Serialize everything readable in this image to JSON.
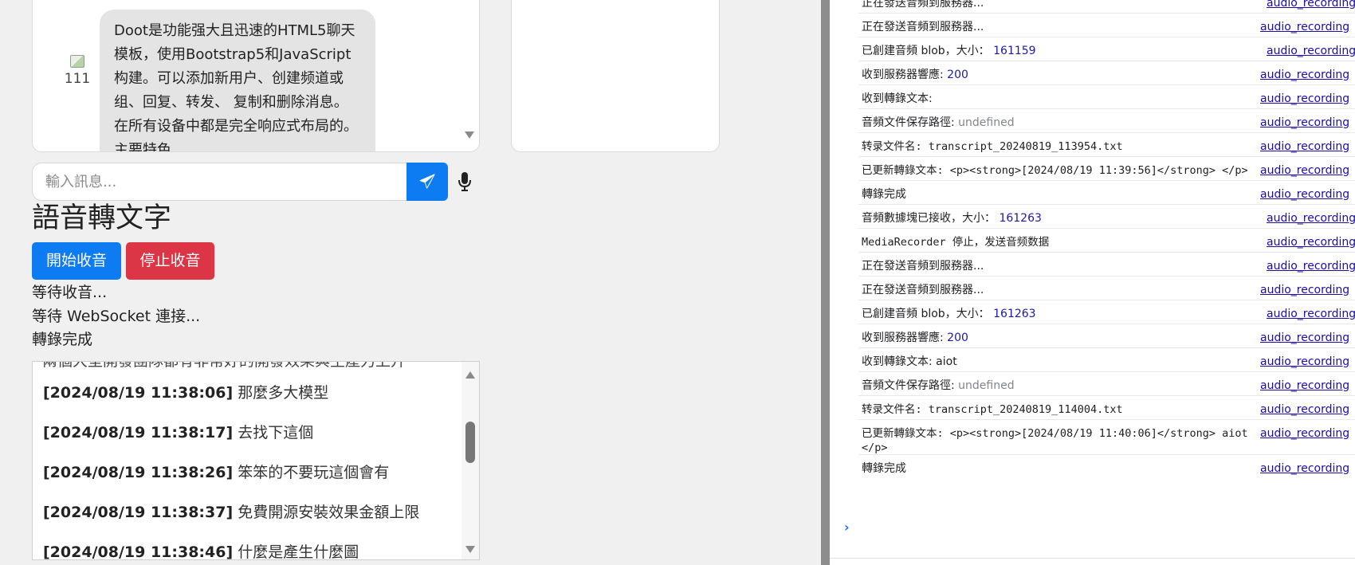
{
  "chat": {
    "avatar_alt": "111",
    "bubble_text": "Doot是功能强大且迅速的HTML5聊天模板，使用Bootstrap5和JavaScript构建。可以添加新用户、创建频道或组、回复、转发、 复制和删除消息。在所有设备中都是完全响应式布局的。主要特色"
  },
  "composer": {
    "placeholder": "輸入訊息..."
  },
  "stt": {
    "title": "語音轉文字",
    "start_label": "開始收音",
    "stop_label": "停止收音",
    "status_recording": "等待收音...",
    "status_ws": "等待 WebSocket 連接...",
    "status_done": "轉錄完成"
  },
  "transcript": {
    "partial_top": "兩個大型開發團隊都有非常好的開發效果與生產力上升",
    "entries": [
      {
        "time": "[2024/08/19 11:38:06]",
        "text": "那麼多大模型"
      },
      {
        "time": "[2024/08/19 11:38:17]",
        "text": "去找下這個"
      },
      {
        "time": "[2024/08/19 11:38:26]",
        "text": "笨笨的不要玩這個會有"
      },
      {
        "time": "[2024/08/19 11:38:37]",
        "text": "免費開源安裝效果金額上限"
      },
      {
        "time": "[2024/08/19 11:38:46]",
        "text": "什麼是產生什麼圖"
      }
    ]
  },
  "console": {
    "source_label": "audio_recording",
    "rows": [
      {
        "text": "正在發送音頻到服務器...",
        "num": "",
        "undef": "",
        "mono": false
      },
      {
        "text": "正在發送音頻到服務器...",
        "num": "",
        "undef": "",
        "mono": false
      },
      {
        "text": "已創建音頻 blob，大小： ",
        "num": "161159",
        "undef": "",
        "mono": false
      },
      {
        "text": "收到服務器響應: ",
        "num": "200",
        "undef": "",
        "mono": false
      },
      {
        "text": "收到轉錄文本: ",
        "num": "",
        "undef": "",
        "mono": false
      },
      {
        "text": "音頻文件保存路徑: ",
        "num": "",
        "undef": "undefined",
        "mono": false
      },
      {
        "text": "转录文件名: transcript_20240819_113954.txt",
        "num": "",
        "undef": "",
        "mono": false
      },
      {
        "text": "已更新轉錄文本: <p><strong>[2024/08/19 11:39:56]</strong> </p>",
        "num": "",
        "undef": "",
        "mono": false
      },
      {
        "text": "轉錄完成",
        "num": "",
        "undef": "",
        "mono": false
      },
      {
        "text": "音頻數據塊已接收，大小： ",
        "num": "161263",
        "undef": "",
        "mono": false
      },
      {
        "text": "MediaRecorder 停止，发送音频数据",
        "num": "",
        "undef": "",
        "mono": false
      },
      {
        "text": "正在發送音頻到服務器...",
        "num": "",
        "undef": "",
        "mono": false
      },
      {
        "text": "正在發送音頻到服務器...",
        "num": "",
        "undef": "",
        "mono": false
      },
      {
        "text": "已創建音頻 blob，大小： ",
        "num": "161263",
        "undef": "",
        "mono": false
      },
      {
        "text": "收到服務器響應: ",
        "num": "200",
        "undef": "",
        "mono": false
      },
      {
        "text": "收到轉錄文本: aiot",
        "num": "",
        "undef": "",
        "mono": false
      },
      {
        "text": "音頻文件保存路徑: ",
        "num": "",
        "undef": "undefined",
        "mono": false
      },
      {
        "text": "转录文件名: transcript_20240819_114004.txt",
        "num": "",
        "undef": "",
        "mono": false
      },
      {
        "text": "已更新轉錄文本: <p><strong>[2024/08/19 11:40:06]</strong> aiot </p>",
        "num": "",
        "undef": "",
        "mono": false
      },
      {
        "text": "轉錄完成",
        "num": "",
        "undef": "",
        "mono": false
      }
    ],
    "prompt_glyph": "›"
  },
  "colors": {
    "primary": "#0d7cf2",
    "danger": "#dc3545",
    "console_link": "#1a0dab",
    "console_number": "#1a1aa6"
  },
  "icons": {
    "send": "send-icon",
    "mic": "microphone-icon",
    "broken_image": "broken-image-icon"
  }
}
